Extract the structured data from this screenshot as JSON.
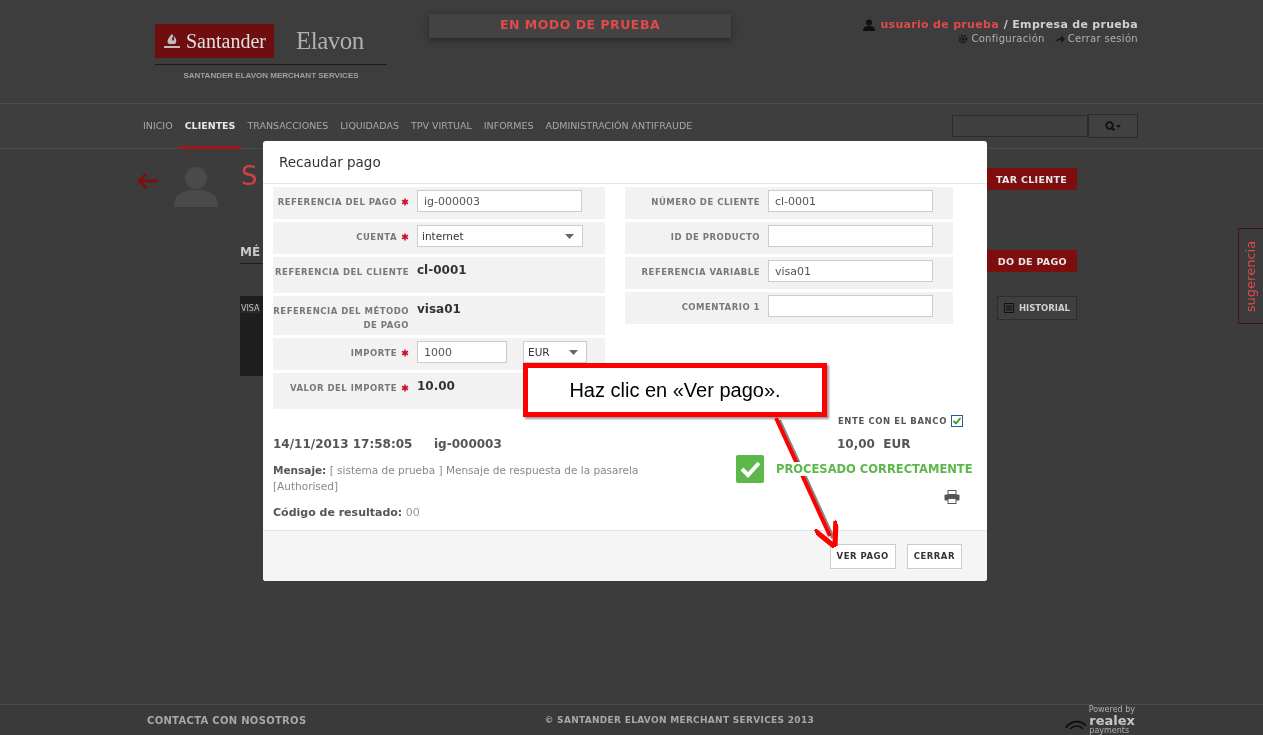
{
  "header": {
    "brand": {
      "bank": "Santander",
      "partner": "Elavon",
      "tagline": "SANTANDER ELAVON MERCHANT SERVICES"
    },
    "mode_banner": "EN MODO DE PRUEBA",
    "user": {
      "name": "usuario de prueba",
      "company": "/ Empresa de prueba",
      "settings": "Configuración",
      "logout": "Cerrar sesión"
    }
  },
  "nav": {
    "items": [
      {
        "label": "INICIO",
        "selected": false
      },
      {
        "label": "CLIENTES",
        "selected": true
      },
      {
        "label": "TRANSACCIONES",
        "selected": false
      },
      {
        "label": "LIQUIDADAS",
        "selected": false
      },
      {
        "label": "TPV VIRTUAL",
        "selected": false
      },
      {
        "label": "INFORMES",
        "selected": false
      },
      {
        "label": "ADMINISTRACIÓN ANTIFRAUDE",
        "selected": false
      }
    ]
  },
  "background": {
    "title": "S",
    "edit_button": "TAR CLIENTE",
    "section_heading": "MÉ",
    "add_button": "DO DE PAGO",
    "history_button": "HISTORIAL",
    "card_label": "VISA",
    "feedback_tab": "sugerencia"
  },
  "modal": {
    "title": "Recaudar pago",
    "left_fields": [
      {
        "kind": "input",
        "label": "REFERENCIA DEL PAGO",
        "required": true,
        "value": "ig-000003"
      },
      {
        "kind": "select",
        "label": "CUENTA",
        "required": true,
        "value": "internet"
      },
      {
        "kind": "text",
        "label": "REFERENCIA DEL CLIENTE",
        "required": false,
        "value": "cl-0001"
      },
      {
        "kind": "text",
        "label": "REFERENCIA DEL MÉTODO DE PAGO",
        "required": false,
        "value": "visa01"
      },
      {
        "kind": "amount",
        "label": "IMPORTE",
        "required": true,
        "value": "1000",
        "currency": "EUR"
      },
      {
        "kind": "text",
        "label": "VALOR DEL IMPORTE",
        "required": true,
        "value": "10.00"
      }
    ],
    "right_fields": [
      {
        "kind": "input",
        "label": "NÚMERO DE CLIENTE",
        "required": false,
        "value": "cl-0001"
      },
      {
        "kind": "input",
        "label": "ID DE PRODUCTO",
        "required": false
      },
      {
        "kind": "input",
        "label": "REFERENCIA VARIABLE",
        "required": false,
        "value": "visa01"
      },
      {
        "kind": "input",
        "label": "COMENTARIO 1",
        "required": false
      }
    ],
    "reconcile": {
      "label": "ENTE CON EL BANCO",
      "checked": true
    },
    "result": {
      "datetime": "14/11/2013 17:58:05",
      "reference": "ig-000003",
      "amount": "10,00  EUR",
      "message_label": "Mensaje:",
      "message": "[ sistema de prueba ] Mensaje de respuesta de la pasarela [Authorised]",
      "status": {
        "kind": "success",
        "text": "PROCESADO CORRECTAMENTE"
      },
      "code_label": "Código de resultado:",
      "code": "00"
    },
    "buttons": [
      "VER PAGO",
      "CERRAR"
    ]
  },
  "callout": {
    "text": "Haz clic en «Ver pago»."
  },
  "footer": {
    "contact": "CONTACTA CON NOSOTROS",
    "copyright": "© SANTANDER ELAVON MERCHANT SERVICES 2013",
    "powered": "Powered by",
    "provider": "realex",
    "provider_sub": "payments"
  }
}
